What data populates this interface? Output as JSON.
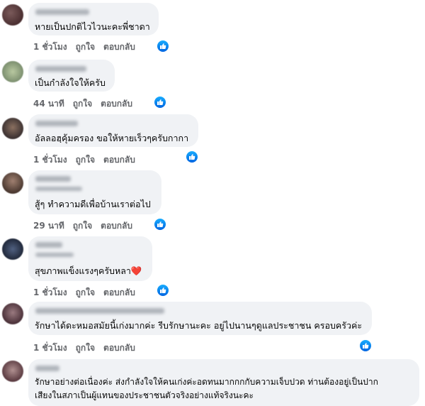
{
  "comments": [
    {
      "text": "หายเป็นปกติไวไวนะคะพี่ชาดา",
      "time": "1 ชั่วโมง",
      "like": "ถูกใจ",
      "reply": "ตอบกลับ",
      "reaction_icon": "like-icon"
    },
    {
      "text": "เป็นกำลังใจให้ครับ",
      "time": "44 นาที",
      "like": "ถูกใจ",
      "reply": "ตอบกลับ",
      "reaction_icon": "like-icon"
    },
    {
      "text": "อัลลอฮฺคุ้มครอง ขอให้หายเร็วๆครับกากา",
      "time": "1 ชั่วโมง",
      "like": "ถูกใจ",
      "reply": "ตอบกลับ",
      "reaction_icon": "like-icon"
    },
    {
      "text": "สู้ๆ ทำความดีเพื่อบ้านเราต่อไป",
      "time": "29 นาที",
      "like": "ถูกใจ",
      "reply": "ตอบกลับ",
      "reaction_icon": "like-icon"
    },
    {
      "text": "สุขภาพแข็งแรงๆครับหลา",
      "emoji": "❤️",
      "time": "1 ชั่วโมง",
      "like": "ถูกใจ",
      "reply": "ตอบกลับ",
      "reaction_icon": "like-icon"
    },
    {
      "text": "รักษาได้ดะหมอสมัยนี้เก่งมากค่ะ รีบรักษานะคะ อยู่ไปนานๆดูแลประชาชน ครอบครัวค่ะ",
      "time": "1 ชั่วโมง",
      "like": "ถูกใจ",
      "reply": "ตอบกลับ",
      "reaction_icon": "like-icon"
    },
    {
      "text_lines": [
        "รักษาอย่างต่อเนื่องค่ะ ส่งกำลังใจให้คนเก่งค่ะอดทนมากกกกับความเจ็บปวด ท่านต้องอยู่เป็นปาก",
        "เสียงในสภาเป็นผู้แทนของประชาชนตัวจริงอย่างแท้จริงนะคะ"
      ]
    }
  ],
  "colors": {
    "bubble": "#f0f2f5",
    "meta": "#65676b",
    "like_blue": "#0866ff",
    "heart": "#e41e3f"
  }
}
